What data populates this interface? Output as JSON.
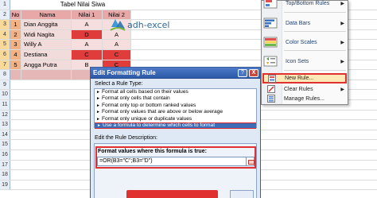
{
  "sheet": {
    "title": "Tabel Nilai Siwa",
    "headers": {
      "no": "No",
      "name": "Nama",
      "v1": "Nilai 1",
      "v2": "Nilai 2"
    },
    "row_numbers": [
      "1",
      "2",
      "3",
      "4",
      "5",
      "6",
      "7",
      "8",
      "9",
      "10",
      "11",
      "12",
      "13",
      "14",
      "15",
      "16",
      "17",
      "18",
      "19"
    ],
    "rows": [
      {
        "no": "1",
        "name": "Dian Anggita",
        "v1": "A",
        "v2": "A"
      },
      {
        "no": "2",
        "name": "Widi Nagita",
        "v1": "D",
        "v2": "A"
      },
      {
        "no": "3",
        "name": "Willy A",
        "v1": "A",
        "v2": "A"
      },
      {
        "no": "4",
        "name": "Destiana",
        "v1": "C",
        "v2": "C"
      },
      {
        "no": "5",
        "name": "Angga Putra",
        "v1": "B",
        "v2": "C"
      }
    ]
  },
  "logo": {
    "text": "adh-excel"
  },
  "cf_menu": {
    "items": [
      {
        "label": "Top/Bottom Rules",
        "icon": "top-bottom-icon"
      },
      {
        "label": "Data Bars",
        "icon": "data-bars-icon"
      },
      {
        "label": "Color Scales",
        "icon": "color-scales-icon"
      },
      {
        "label": "Icon Sets",
        "icon": "icon-sets-icon"
      }
    ],
    "new_rule": "New Rule...",
    "clear_rules": "Clear Rules",
    "manage_rules": "Manage Rules..."
  },
  "dialog": {
    "title": "Edit Formatting Rule",
    "help": "?",
    "close": "X",
    "select_type_label": "Select a Rule Type:",
    "rule_types": [
      "Format all cells based on their values",
      "Format only cells that contain",
      "Format only top or bottom ranked values",
      "Format only values that are above or below average",
      "Format only unique or duplicate values",
      "Use a formula to determine which cells to format"
    ],
    "edit_desc_label": "Edit the Rule Description:",
    "format_values_label": "Format values where this formula is true:",
    "formula": "=OR(B3=\"C\";B3=\"D\")"
  },
  "colors": {
    "highlight_red": "#e03c3c",
    "header_pink": "#e8a8a8",
    "dialog_blue": "#2c5aa8"
  }
}
